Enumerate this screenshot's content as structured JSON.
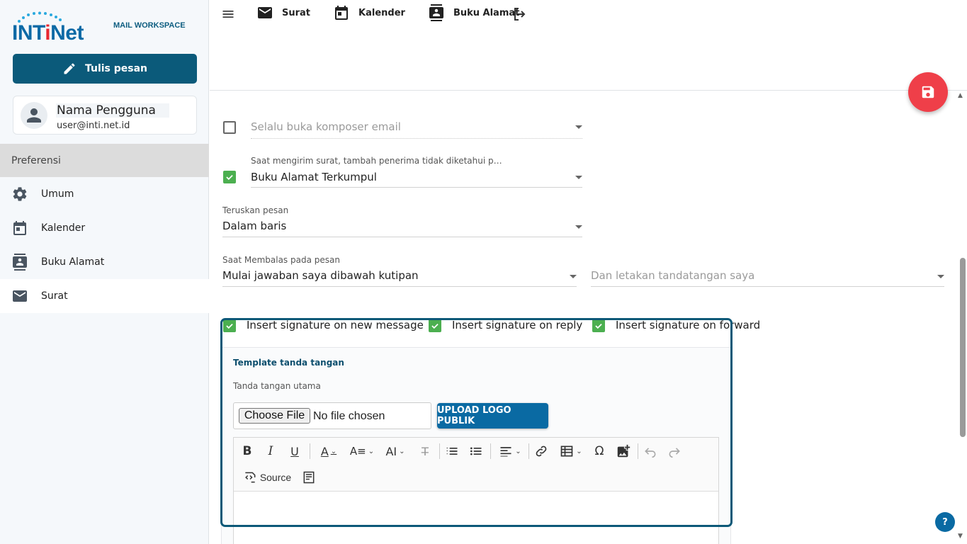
{
  "brand": {
    "logo_text_a": "INT",
    "logo_text_b": "i",
    "logo_text_c": "Net",
    "subtitle": "MAIL WORKSPACE"
  },
  "sidebar": {
    "compose_label": "Tulis pesan",
    "user": {
      "name": "Nama Pengguna",
      "email": "user@inti.net.id"
    },
    "section_header": "Preferensi",
    "items": [
      {
        "label": "Umum",
        "icon": "gear-icon"
      },
      {
        "label": "Kalender",
        "icon": "calendar-icon"
      },
      {
        "label": "Buku Alamat",
        "icon": "contacts-icon"
      },
      {
        "label": "Surat",
        "icon": "mail-icon",
        "active": true
      }
    ]
  },
  "topbar": {
    "items": [
      {
        "label": "Surat",
        "icon": "mail-icon"
      },
      {
        "label": "Kalender",
        "icon": "calendar-icon"
      },
      {
        "label": "Buku Alamat",
        "icon": "contacts-icon"
      }
    ]
  },
  "form": {
    "always_open_composer": {
      "checked": false,
      "value": "Selalu buka komposer email"
    },
    "add_unknown_recipients": {
      "checked": true,
      "label": "Saat mengirim surat, tambah penerima tidak diketahui pada s...",
      "value": "Buku Alamat Terkumpul"
    },
    "forward": {
      "label": "Teruskan pesan",
      "value": "Dalam baris"
    },
    "reply": {
      "label": "Saat Membalas pada pesan",
      "value": "Mulai jawaban saya dibawah kutipan"
    },
    "signature_position": {
      "value": "Dan letakan tandatangan saya"
    },
    "signature_checks": [
      {
        "label": "Insert signature on new message",
        "checked": true
      },
      {
        "label": "Insert signature on reply",
        "checked": true
      },
      {
        "label": "Insert signature on forward",
        "checked": true
      }
    ]
  },
  "signature": {
    "section_title": "Template tanda tangan",
    "sub_title": "Tanda tangan utama",
    "choose_file": "Choose File",
    "no_file": "No file chosen",
    "upload_label": "UPLOAD LOGO PUBLIK",
    "source_label": "Source"
  },
  "help_label": "?",
  "colors": {
    "brand_blue": "#0b5a7a",
    "accent_red": "#ef3f49",
    "check_green": "#4caf50",
    "upload_blue": "#0a6aa3"
  }
}
